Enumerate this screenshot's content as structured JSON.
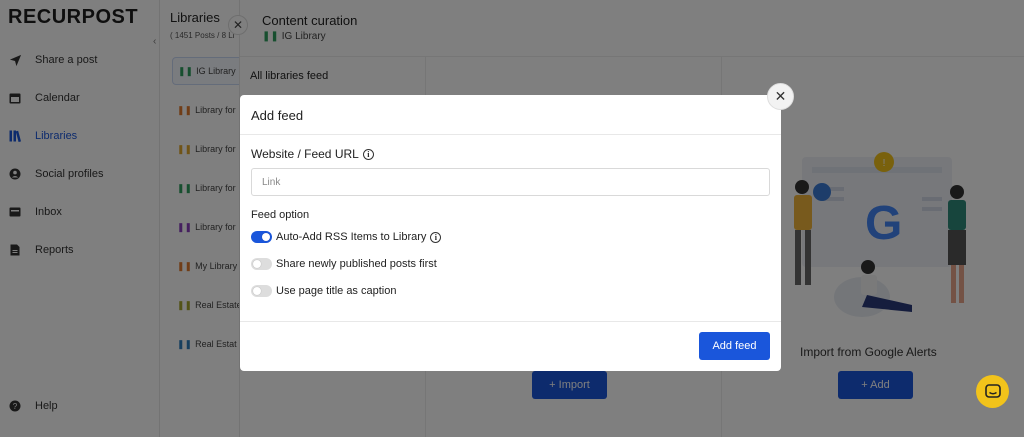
{
  "brand": {
    "logo_text": "RECURPOST"
  },
  "sidebar": {
    "items": [
      {
        "label": "Share a post",
        "icon": "send-icon"
      },
      {
        "label": "Calendar",
        "icon": "calendar-icon"
      },
      {
        "label": "Libraries",
        "icon": "library-icon",
        "active": true
      },
      {
        "label": "Social profiles",
        "icon": "user-icon"
      },
      {
        "label": "Inbox",
        "icon": "inbox-icon"
      },
      {
        "label": "Reports",
        "icon": "report-icon"
      }
    ],
    "help_label": "Help"
  },
  "libraries": {
    "title": "Libraries",
    "subtitle": "( 1451 Posts / 8 Li",
    "items": [
      {
        "label": "IG Library",
        "selected": true
      },
      {
        "label": "Library for"
      },
      {
        "label": "Library for"
      },
      {
        "label": "Library for"
      },
      {
        "label": "Library for"
      },
      {
        "label": "My Library"
      },
      {
        "label": "Real Estate"
      },
      {
        "label": "Real Estat"
      }
    ]
  },
  "curation": {
    "title": "Content curation",
    "library_name": "IG Library",
    "feed_section_title": "All libraries feed",
    "import_button": "+ Import",
    "google_alerts_label": "Import from Google Alerts",
    "add_button": "+ Add"
  },
  "modal": {
    "title": "Add feed",
    "url_label": "Website / Feed URL",
    "url_placeholder": "Link",
    "url_value": "",
    "feed_option_title": "Feed option",
    "options": [
      {
        "label": "Auto-Add RSS Items to Library",
        "on": true
      },
      {
        "label": "Share newly published posts first",
        "on": false
      },
      {
        "label": "Use page title as caption",
        "on": false
      }
    ],
    "submit_label": "Add feed"
  },
  "colors": {
    "accent": "#1a56db",
    "chat": "#f2c31b",
    "overlay": "rgba(0,0,0,0.5)"
  }
}
